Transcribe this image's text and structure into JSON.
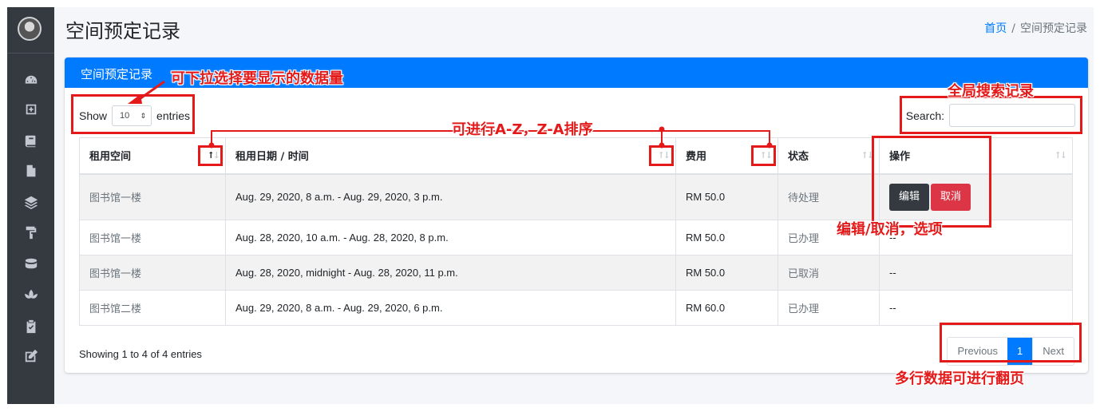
{
  "sidebar": {
    "items": [
      {
        "icon": "dashboard-icon"
      },
      {
        "icon": "plus-square-icon"
      },
      {
        "icon": "book-icon"
      },
      {
        "icon": "file-icon"
      },
      {
        "icon": "layers-icon"
      },
      {
        "icon": "paint-roller-icon"
      },
      {
        "icon": "database-icon"
      },
      {
        "icon": "spa-icon"
      },
      {
        "icon": "clipboard-check-icon"
      },
      {
        "icon": "edit-icon"
      }
    ]
  },
  "header": {
    "title": "空间预定记录",
    "breadcrumb_home": "首页",
    "breadcrumb_sep": "/",
    "breadcrumb_current": "空间预定记录"
  },
  "card": {
    "title": "空间预定记录",
    "show_label": "Show",
    "entries_value": "10",
    "entries_label": "entries",
    "search_label": "Search:",
    "search_value": ""
  },
  "table": {
    "columns": [
      "租用空间",
      "租用日期 / 时间",
      "费用",
      "状态",
      "操作"
    ],
    "rows": [
      {
        "space": "图书馆一楼",
        "datetime": "Aug. 29, 2020, 8 a.m. - Aug. 29, 2020, 3 p.m.",
        "fee": "RM 50.0",
        "status": "待处理",
        "action": "buttons"
      },
      {
        "space": "图书馆一楼",
        "datetime": "Aug. 28, 2020, 10 a.m. - Aug. 28, 2020, 8 p.m.",
        "fee": "RM 50.0",
        "status": "已办理",
        "action": "--"
      },
      {
        "space": "图书馆一楼",
        "datetime": "Aug. 28, 2020, midnight - Aug. 28, 2020, 11 p.m.",
        "fee": "RM 50.0",
        "status": "已取消",
        "action": "--"
      },
      {
        "space": "图书馆二楼",
        "datetime": "Aug. 29, 2020, 8 a.m. - Aug. 29, 2020, 6 p.m.",
        "fee": "RM 60.0",
        "status": "已办理",
        "action": "--"
      }
    ],
    "edit_label": "编辑",
    "cancel_label": "取消"
  },
  "footer": {
    "info": "Showing 1 to 4 of 4 entries",
    "prev": "Previous",
    "page": "1",
    "next": "Next"
  },
  "annotations": {
    "dropdown_note": "可下拉选择要显示的数据量",
    "search_note": "全局搜索记录",
    "sort_note": "可进行A-Z，Z-A排序",
    "edit_note": "编辑/取消，选项",
    "paging_note": "多行数据可进行翻页"
  },
  "colors": {
    "primary": "#007bff",
    "sidebar": "#343a40",
    "danger": "#dc3545",
    "annotation": "#e41a1a"
  }
}
